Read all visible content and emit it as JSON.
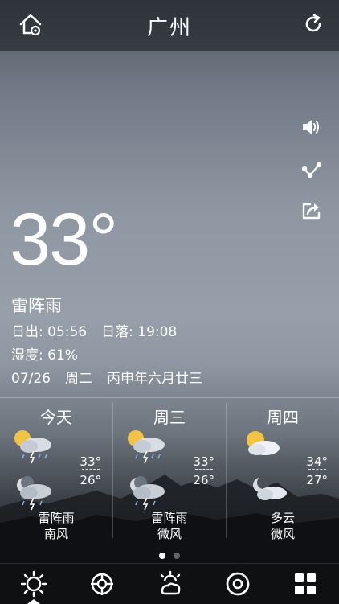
{
  "header": {
    "city": "广州"
  },
  "current": {
    "temperature": "33°",
    "condition": "雷阵雨",
    "sunrise": "日出: 05:56",
    "sunset": "日落: 19:08",
    "humidity": "湿度: 61%",
    "date": "07/26",
    "weekday": "周二",
    "lunar": "丙申年六月廿三"
  },
  "side_actions": [
    "speaker-icon",
    "share-nodes-icon",
    "export-icon"
  ],
  "forecast": [
    {
      "day": "今天",
      "high": "33°",
      "low": "26°",
      "desc": "雷阵雨",
      "wind": "南风",
      "day_icon": "thunderstorm-icon",
      "night_icon": "night-thunderstorm-icon"
    },
    {
      "day": "周三",
      "high": "33°",
      "low": "26°",
      "desc": "雷阵雨",
      "wind": "微风",
      "day_icon": "thunderstorm-icon",
      "night_icon": "night-thunderstorm-icon"
    },
    {
      "day": "周四",
      "high": "34°",
      "low": "27°",
      "desc": "多云",
      "wind": "微风",
      "day_icon": "partly-cloudy-icon",
      "night_icon": "night-cloudy-icon"
    }
  ],
  "pager": {
    "pages": 2,
    "active": 1
  },
  "tabs": [
    "weather-tab-icon",
    "life-index-tab-icon",
    "forecast-tab-icon",
    "typhoon-tab-icon",
    "more-tab-icon"
  ]
}
